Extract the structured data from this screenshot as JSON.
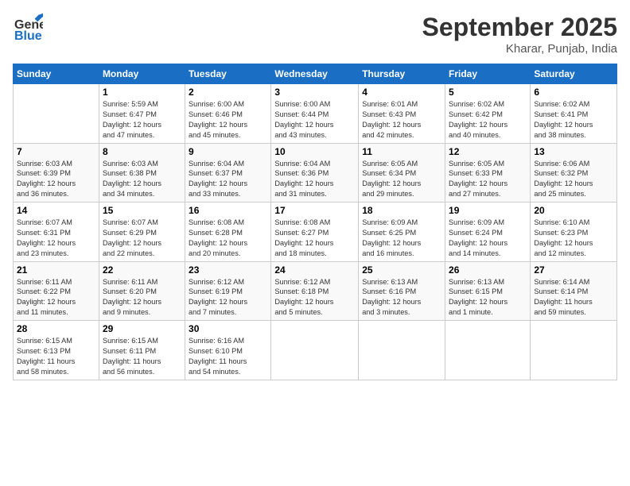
{
  "header": {
    "logo_line1": "General",
    "logo_line2": "Blue",
    "month": "September 2025",
    "location": "Kharar, Punjab, India"
  },
  "days_of_week": [
    "Sunday",
    "Monday",
    "Tuesday",
    "Wednesday",
    "Thursday",
    "Friday",
    "Saturday"
  ],
  "weeks": [
    [
      {
        "day": "",
        "info": ""
      },
      {
        "day": "1",
        "info": "Sunrise: 5:59 AM\nSunset: 6:47 PM\nDaylight: 12 hours\nand 47 minutes."
      },
      {
        "day": "2",
        "info": "Sunrise: 6:00 AM\nSunset: 6:46 PM\nDaylight: 12 hours\nand 45 minutes."
      },
      {
        "day": "3",
        "info": "Sunrise: 6:00 AM\nSunset: 6:44 PM\nDaylight: 12 hours\nand 43 minutes."
      },
      {
        "day": "4",
        "info": "Sunrise: 6:01 AM\nSunset: 6:43 PM\nDaylight: 12 hours\nand 42 minutes."
      },
      {
        "day": "5",
        "info": "Sunrise: 6:02 AM\nSunset: 6:42 PM\nDaylight: 12 hours\nand 40 minutes."
      },
      {
        "day": "6",
        "info": "Sunrise: 6:02 AM\nSunset: 6:41 PM\nDaylight: 12 hours\nand 38 minutes."
      }
    ],
    [
      {
        "day": "7",
        "info": "Sunrise: 6:03 AM\nSunset: 6:39 PM\nDaylight: 12 hours\nand 36 minutes."
      },
      {
        "day": "8",
        "info": "Sunrise: 6:03 AM\nSunset: 6:38 PM\nDaylight: 12 hours\nand 34 minutes."
      },
      {
        "day": "9",
        "info": "Sunrise: 6:04 AM\nSunset: 6:37 PM\nDaylight: 12 hours\nand 33 minutes."
      },
      {
        "day": "10",
        "info": "Sunrise: 6:04 AM\nSunset: 6:36 PM\nDaylight: 12 hours\nand 31 minutes."
      },
      {
        "day": "11",
        "info": "Sunrise: 6:05 AM\nSunset: 6:34 PM\nDaylight: 12 hours\nand 29 minutes."
      },
      {
        "day": "12",
        "info": "Sunrise: 6:05 AM\nSunset: 6:33 PM\nDaylight: 12 hours\nand 27 minutes."
      },
      {
        "day": "13",
        "info": "Sunrise: 6:06 AM\nSunset: 6:32 PM\nDaylight: 12 hours\nand 25 minutes."
      }
    ],
    [
      {
        "day": "14",
        "info": "Sunrise: 6:07 AM\nSunset: 6:31 PM\nDaylight: 12 hours\nand 23 minutes."
      },
      {
        "day": "15",
        "info": "Sunrise: 6:07 AM\nSunset: 6:29 PM\nDaylight: 12 hours\nand 22 minutes."
      },
      {
        "day": "16",
        "info": "Sunrise: 6:08 AM\nSunset: 6:28 PM\nDaylight: 12 hours\nand 20 minutes."
      },
      {
        "day": "17",
        "info": "Sunrise: 6:08 AM\nSunset: 6:27 PM\nDaylight: 12 hours\nand 18 minutes."
      },
      {
        "day": "18",
        "info": "Sunrise: 6:09 AM\nSunset: 6:25 PM\nDaylight: 12 hours\nand 16 minutes."
      },
      {
        "day": "19",
        "info": "Sunrise: 6:09 AM\nSunset: 6:24 PM\nDaylight: 12 hours\nand 14 minutes."
      },
      {
        "day": "20",
        "info": "Sunrise: 6:10 AM\nSunset: 6:23 PM\nDaylight: 12 hours\nand 12 minutes."
      }
    ],
    [
      {
        "day": "21",
        "info": "Sunrise: 6:11 AM\nSunset: 6:22 PM\nDaylight: 12 hours\nand 11 minutes."
      },
      {
        "day": "22",
        "info": "Sunrise: 6:11 AM\nSunset: 6:20 PM\nDaylight: 12 hours\nand 9 minutes."
      },
      {
        "day": "23",
        "info": "Sunrise: 6:12 AM\nSunset: 6:19 PM\nDaylight: 12 hours\nand 7 minutes."
      },
      {
        "day": "24",
        "info": "Sunrise: 6:12 AM\nSunset: 6:18 PM\nDaylight: 12 hours\nand 5 minutes."
      },
      {
        "day": "25",
        "info": "Sunrise: 6:13 AM\nSunset: 6:16 PM\nDaylight: 12 hours\nand 3 minutes."
      },
      {
        "day": "26",
        "info": "Sunrise: 6:13 AM\nSunset: 6:15 PM\nDaylight: 12 hours\nand 1 minute."
      },
      {
        "day": "27",
        "info": "Sunrise: 6:14 AM\nSunset: 6:14 PM\nDaylight: 11 hours\nand 59 minutes."
      }
    ],
    [
      {
        "day": "28",
        "info": "Sunrise: 6:15 AM\nSunset: 6:13 PM\nDaylight: 11 hours\nand 58 minutes."
      },
      {
        "day": "29",
        "info": "Sunrise: 6:15 AM\nSunset: 6:11 PM\nDaylight: 11 hours\nand 56 minutes."
      },
      {
        "day": "30",
        "info": "Sunrise: 6:16 AM\nSunset: 6:10 PM\nDaylight: 11 hours\nand 54 minutes."
      },
      {
        "day": "",
        "info": ""
      },
      {
        "day": "",
        "info": ""
      },
      {
        "day": "",
        "info": ""
      },
      {
        "day": "",
        "info": ""
      }
    ]
  ]
}
